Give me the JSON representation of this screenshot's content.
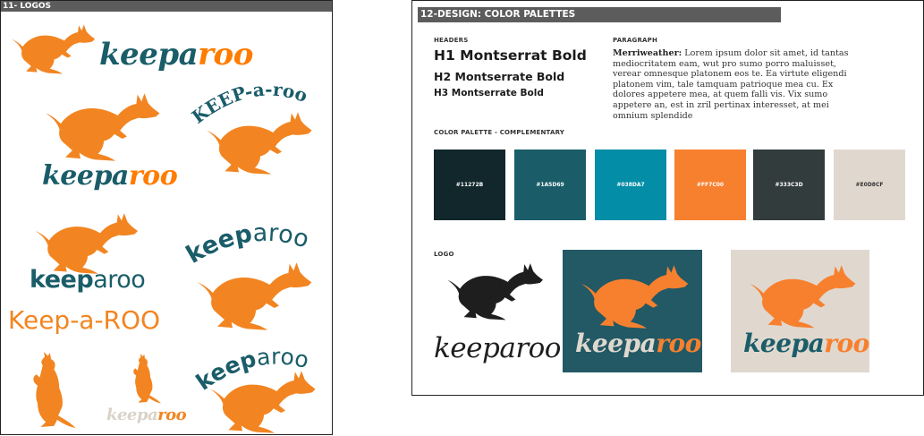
{
  "left": {
    "header": "11- LOGOS",
    "logos": {
      "top_a": "keepa",
      "top_b": "roo",
      "mid_a": "keepa",
      "mid_b": "roo",
      "arc_text": "KEEP-a-roo",
      "sans_a": "keep",
      "sans_b": "aroo",
      "keeparoo_arc_a": "keep",
      "keeparoo_arc_b": "aroo",
      "keep_a_roo": "Keep-a-ROO",
      "small_a": "keepa",
      "small_b": "roo",
      "br_a": "keep",
      "br_b": "aroo"
    }
  },
  "right": {
    "header": "12-DESIGN: COLOR PALETTES",
    "headers_label": "HEADERS",
    "paragraph_label": "PARAGRAPH",
    "h1": "H1 Montserrat Bold",
    "h2": "H2 Montserrate Bold",
    "h3": "H3 Montserrate Bold",
    "para_font": "Merriweather:",
    "para_text": "Lorem ipsum dolor sit amet, id tantas mediocritatem eam, wut pro sumo porro maluisset, verear omnesque platonem eos te. Ea virtute eligendi platonem vim, tale tamquam patrioque mea cu. Ex dolores appetere mea, at quem falli vis. Vix sumo appetere an, est in zril pertinax interesset, at mei omnium splendide",
    "palette_label": "COLOR PALETTE - COMPLEMENTARY",
    "swatches": [
      {
        "hex": "#11272B",
        "color": "#11272b",
        "text_color": "#ffffff"
      },
      {
        "hex": "#1A5D69",
        "color": "#1a5d69",
        "text_color": "#ffffff"
      },
      {
        "hex": "#038DA7",
        "color": "#038da7",
        "text_color": "#ffffff"
      },
      {
        "hex": "#FF7C00",
        "color": "#f7802f",
        "text_color": "#ffffff"
      },
      {
        "hex": "#333C3D",
        "color": "#333c3d",
        "text_color": "#ffffff"
      },
      {
        "hex": "#E0D8CF",
        "color": "#e0d8cf",
        "text_color": "#333333"
      }
    ],
    "logo_label": "LOGO",
    "logo_variants": [
      {
        "a": "keepa",
        "b": "roo",
        "bg": "#ffffff",
        "roo_color": "#1e1e1e",
        "a_color": "#1e1e1e",
        "b_color": "#1e1e1e"
      },
      {
        "a": "keepa",
        "b": "roo",
        "bg": "#225964",
        "roo_color": "#f7802f",
        "a_color": "#e0d8cf",
        "b_color": "#f7802f"
      },
      {
        "a": "keepa",
        "b": "roo",
        "bg": "#e0d8cf",
        "roo_color": "#f7802f",
        "a_color": "#1a5d69",
        "b_color": "#f7802f"
      }
    ]
  },
  "colors": {
    "orange": "#f28521",
    "teal": "#1a5d69",
    "header_gray": "#5d5c5c"
  }
}
